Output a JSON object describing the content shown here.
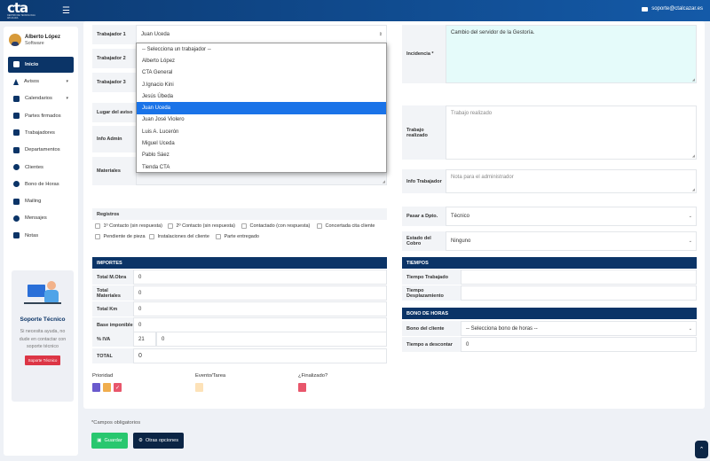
{
  "topbar": {
    "logo_text": "cta",
    "logo_sub": "CENTRO DE TECNOLOGÍA APLICADA",
    "support_email": "soporte@ctalcazar.es"
  },
  "user": {
    "name": "Alberto López",
    "role": "Software"
  },
  "menu": [
    {
      "label": "Inicio",
      "icon": "home-icon"
    },
    {
      "label": "Avisos",
      "icon": "bell-icon"
    },
    {
      "label": "Calendarios",
      "icon": "calendar-icon"
    },
    {
      "label": "Partes firmados",
      "icon": "document-icon"
    },
    {
      "label": "Trabajadores",
      "icon": "id-card-icon"
    },
    {
      "label": "Departamentos",
      "icon": "building-icon"
    },
    {
      "label": "Clientes",
      "icon": "users-icon"
    },
    {
      "label": "Bono de Horas",
      "icon": "clock-icon"
    },
    {
      "label": "Mailing",
      "icon": "mail-icon"
    },
    {
      "label": "Mensajes",
      "icon": "chat-icon"
    },
    {
      "label": "Notas",
      "icon": "note-icon"
    }
  ],
  "support": {
    "title": "Soporte Técnico",
    "text": "Si necesita ayuda, no dude en contactar con soporte técnico",
    "button": "Soporte Técnico"
  },
  "form": {
    "trabajador1_label": "Trabajador 1",
    "trabajador1_value": "Juan Uceda",
    "trabajador2_label": "Trabajador 2",
    "trabajador3_label": "Trabajador 3",
    "lugar_label": "Lugar del aviso",
    "info_admin_label": "Info Admin",
    "materiales_label": "Materiales",
    "incidencia_label": "Incidencia *",
    "incidencia_value": "Cambio del servidor de la Gestoría.",
    "trabajo_realizado_label": "Trabajo realizado",
    "trabajo_realizado_placeholder": "Trabajo realizado",
    "info_trabajador_label": "Info Trabajador",
    "info_trabajador_placeholder": "Nota para el administrador",
    "pasar_label": "Pasar a Dpto.",
    "pasar_value": "Técnico",
    "estado_label": "Estado del Cobro",
    "estado_value": "Ninguno"
  },
  "dropdown": {
    "options": [
      "-- Selecciona un trabajador --",
      "Alberto López",
      "CTA General",
      "J.Ignacio Kini",
      "Jesús Úbeda",
      "Juan Uceda",
      "Juan José Violero",
      "Luis A. Lucerón",
      "Miguel Uceda",
      "Pablo Sáez",
      "Tienda CTA"
    ],
    "selected_index": 5
  },
  "registros": {
    "title": "Registros",
    "checks": [
      "1º Contacto (sin respuesta)",
      "2º Contacto (sin respuesta)",
      "Contactado (con respuesta)",
      "Concertada cita cliente",
      "Pendiente de pieza",
      "Instalaciones del cliente",
      "Parte entregado"
    ]
  },
  "importes": {
    "title": "IMPORTES",
    "rows": [
      {
        "label": "Total M.Obra",
        "value": "0"
      },
      {
        "label": "Total Materiales",
        "value": "0"
      },
      {
        "label": "Total Km",
        "value": "0"
      },
      {
        "label": "Base imponible",
        "value": "0"
      }
    ],
    "iva_label": "% IVA",
    "iva_rate": "21",
    "iva_value": "0",
    "total_label": "TOTAL",
    "total_value": "0"
  },
  "tiempos": {
    "title": "TIEMPOS",
    "rows": [
      {
        "label": "Tiempo Trabajado",
        "value": ""
      },
      {
        "label": "Tiempo Desplazamiento",
        "value": ""
      }
    ]
  },
  "bono": {
    "title": "BONO DE HORAS",
    "cliente_label": "Bono del cliente",
    "cliente_value": "-- Selecciona bono de horas --",
    "descontar_label": "Tiempo a descontar",
    "descontar_value": "0"
  },
  "prioridad": {
    "label": "Prioridad",
    "colors": [
      "#6a5acd",
      "#f0ad4e",
      "#e8566b"
    ],
    "checked_index": 2
  },
  "evento": {
    "label": "Evento/Tarea",
    "color": "#fde2b8"
  },
  "finalizado": {
    "label": "¿Finalizado?",
    "color": "#e8566b"
  },
  "footer": {
    "required_note": "*Campos obligatorios",
    "save": "Guardar",
    "options": "Otras opciones"
  }
}
